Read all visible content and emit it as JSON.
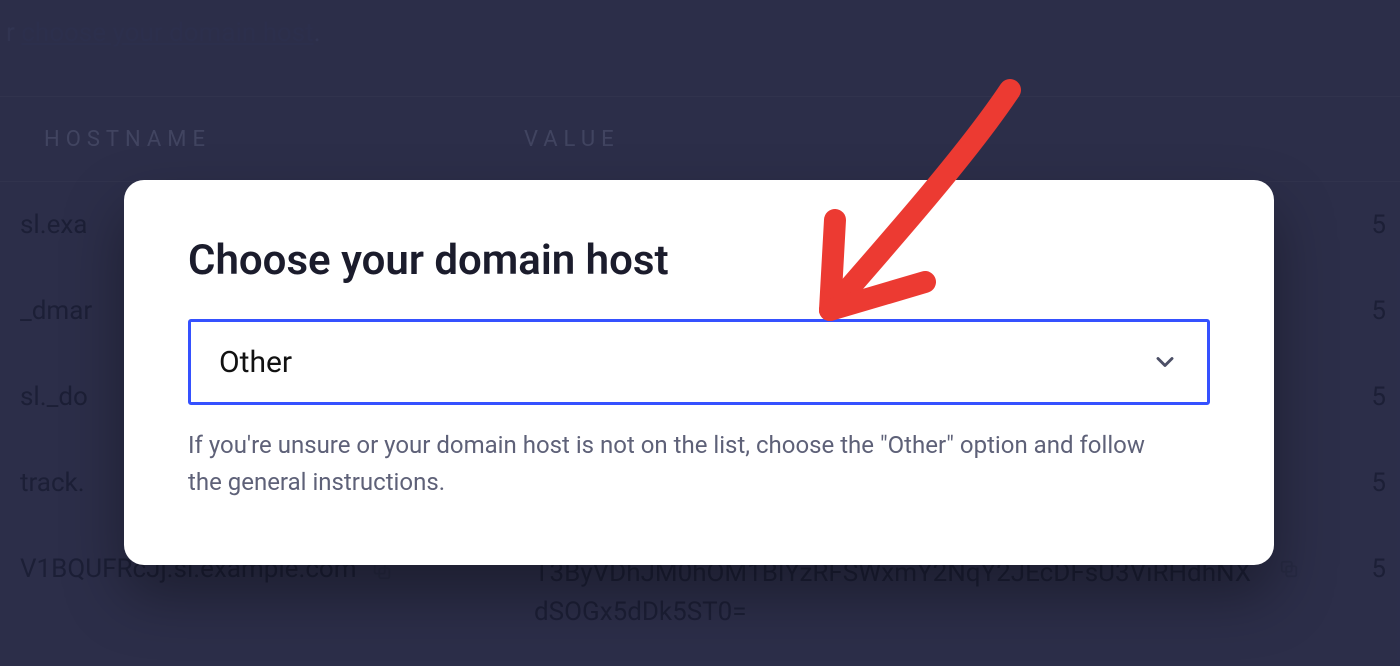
{
  "intro": {
    "prefix": "r ",
    "link_text": "choose your domain host",
    "suffix": "."
  },
  "table": {
    "headers": {
      "hostname": "HOSTNAME",
      "value": "VALUE"
    },
    "rows": [
      {
        "hostname": "sl.exa",
        "value": "",
        "trailing": "5"
      },
      {
        "hostname": "_dmar",
        "value": "",
        "trailing": "5"
      },
      {
        "hostname": "sl._do",
        "value": "",
        "trailing": "5"
      },
      {
        "hostname": "track.",
        "value": "",
        "trailing": "5"
      },
      {
        "hostname": "V1BQUFRcJj.sl.example.com",
        "value": "T3ByVDhJM0hOM1BlYzRFSWxmY2NqY2JEcDFsU3ViRHdhNXdSOGx5dDk5ST0=",
        "trailing": "5"
      }
    ]
  },
  "modal": {
    "title": "Choose your domain host",
    "selected": "Other",
    "hint": "If you're unsure or your domain host is not on the list, choose the \"Other\" option and follow the general instructions."
  }
}
